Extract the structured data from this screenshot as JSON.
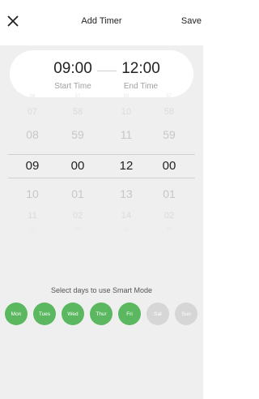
{
  "header": {
    "title": "Add Timer",
    "save_label": "Save",
    "close_icon": "close-icon"
  },
  "time_card": {
    "start_value": "09:00",
    "start_label": "Start Time",
    "end_value": "12:00",
    "end_label": "End Time"
  },
  "picker": {
    "columns": [
      {
        "name": "start-hour",
        "values": [
          "06",
          "07",
          "08",
          "09",
          "10",
          "11",
          "12"
        ]
      },
      {
        "name": "start-minute",
        "values": [
          "57",
          "58",
          "59",
          "00",
          "01",
          "02",
          "03"
        ]
      },
      {
        "name": "end-hour",
        "values": [
          "09",
          "10",
          "11",
          "12",
          "13",
          "14",
          "15"
        ]
      },
      {
        "name": "end-minute",
        "values": [
          "57",
          "58",
          "59",
          "00",
          "01",
          "02",
          "03"
        ]
      }
    ]
  },
  "days": {
    "label": "Select days to use Smart Mode",
    "items": [
      {
        "label": "Mon",
        "selected": true
      },
      {
        "label": "Tues",
        "selected": true
      },
      {
        "label": "Wed",
        "selected": true
      },
      {
        "label": "Thur",
        "selected": true
      },
      {
        "label": "Fri",
        "selected": true
      },
      {
        "label": "Sat",
        "selected": false
      },
      {
        "label": "Sun",
        "selected": false
      }
    ],
    "selected_color": "#5cb860",
    "unselected_color": "#d6d6d6"
  }
}
